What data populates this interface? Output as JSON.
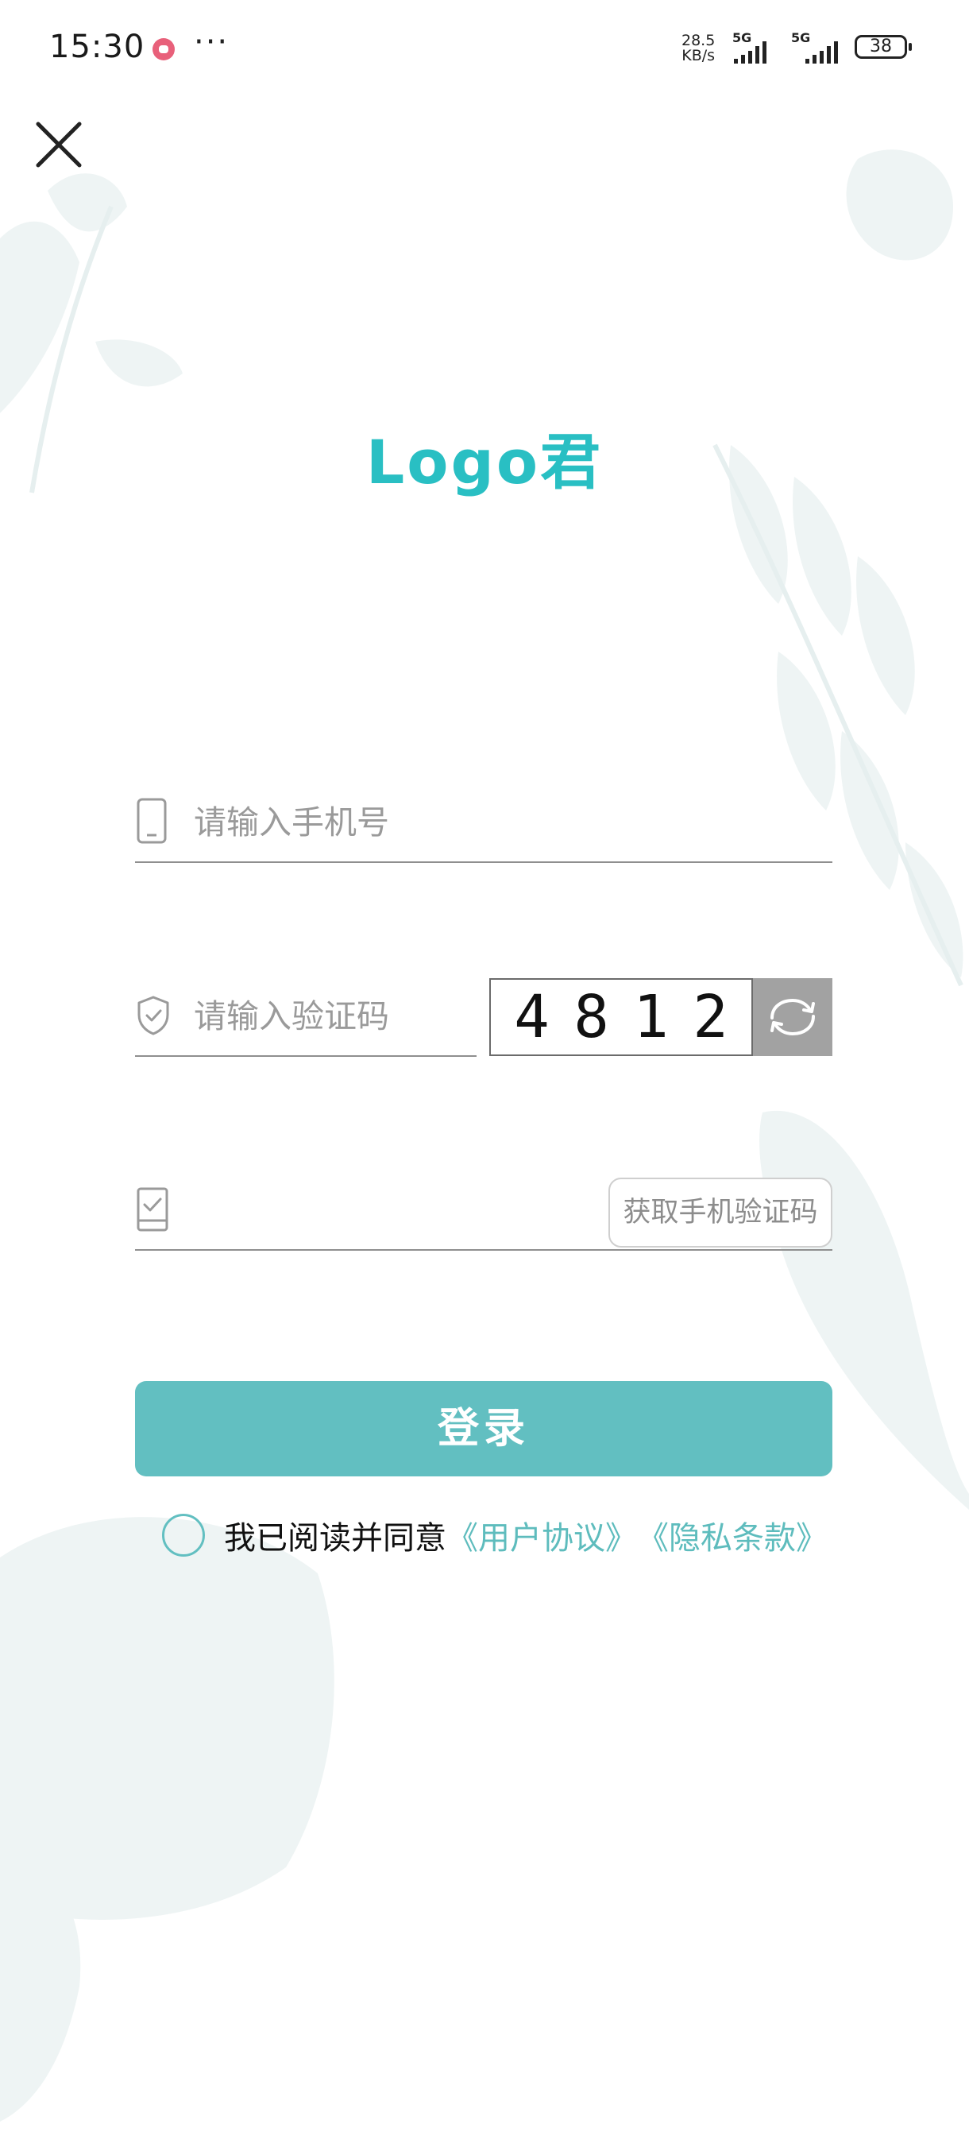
{
  "status_bar": {
    "time": "15:30",
    "more": "···",
    "net_speed_value": "28.5",
    "net_speed_unit": "KB/s",
    "signal_1_label": "5G",
    "signal_2_label": "5G",
    "battery": "38"
  },
  "logo": "Logo君",
  "phone_field": {
    "placeholder": "请输入手机号",
    "value": ""
  },
  "captcha_field": {
    "placeholder": "请输入验证码",
    "value": "",
    "digits": [
      "4",
      "8",
      "1",
      "2"
    ]
  },
  "sms_field": {
    "placeholder": "",
    "value": "",
    "button_label": "获取手机验证码"
  },
  "login_button": "登录",
  "agreement": {
    "text": "我已阅读并同意",
    "user_agreement": "《用户协议》",
    "privacy_policy": "《隐私条款》",
    "checked": false
  },
  "colors": {
    "accent": "#62bfc1",
    "logo": "#29bfc3",
    "placeholder": "#9a9a9a",
    "refresh_bg": "#a2a2a2"
  }
}
